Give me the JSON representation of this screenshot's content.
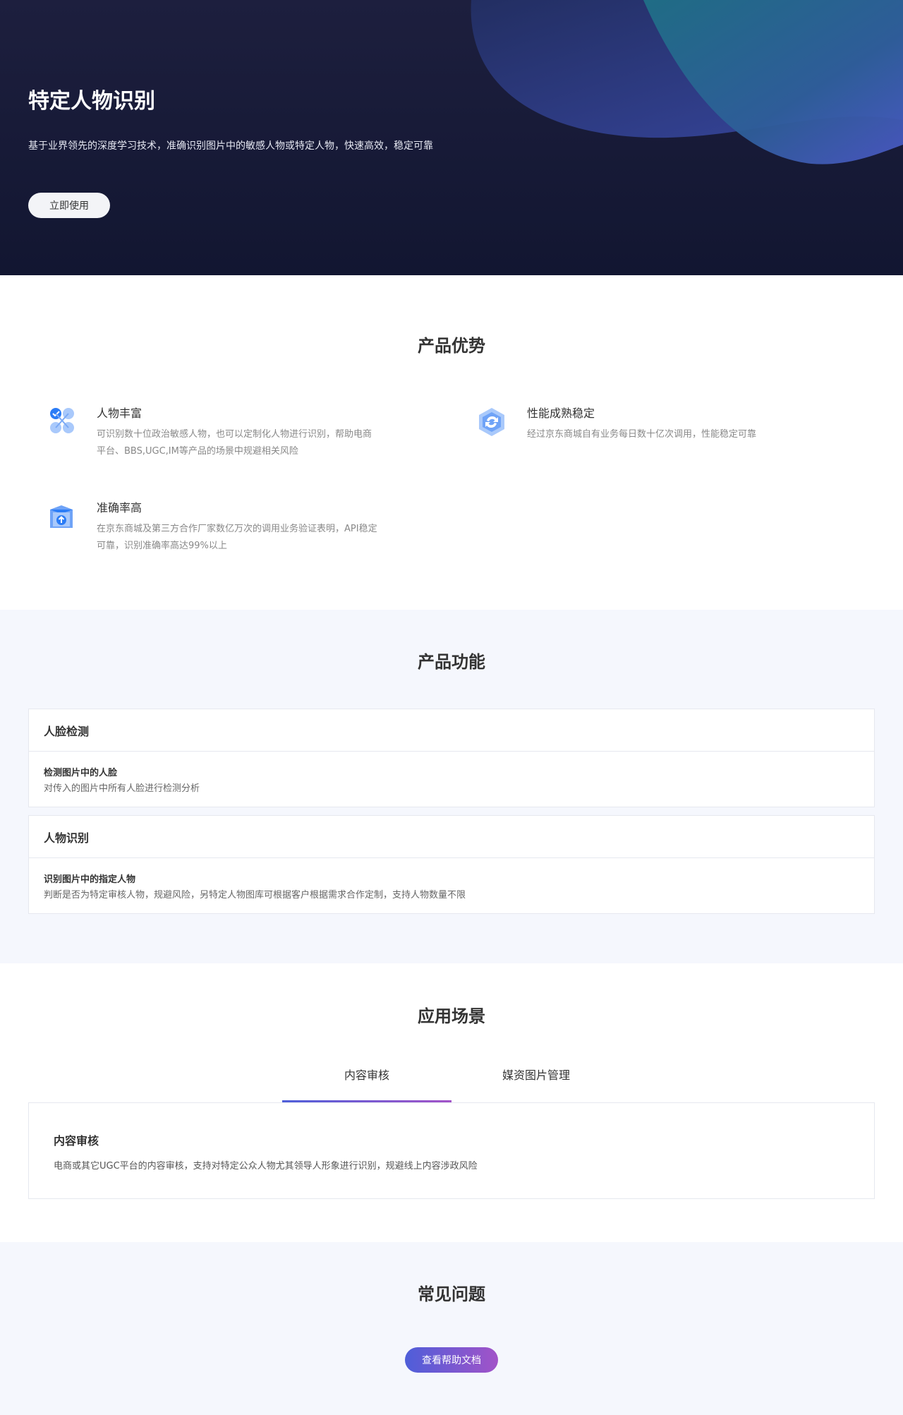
{
  "hero": {
    "title": "特定人物识别",
    "description": "基于业界领先的深度学习技术，准确识别图片中的敏感人物或特定人物，快速高效，稳定可靠",
    "cta_label": "立即使用"
  },
  "advantages": {
    "title": "产品优势",
    "items": [
      {
        "icon": "nodes-check-icon",
        "title": "人物丰富",
        "desc": "可识别数十位政治敏感人物，也可以定制化人物进行识别，帮助电商平台、BBS,UGC,IM等产品的场景中规避相关风险"
      },
      {
        "icon": "refresh-hexagon-icon",
        "title": "性能成熟稳定",
        "desc": "经过京东商城自有业务每日数十亿次调用，性能稳定可靠"
      },
      {
        "icon": "upload-box-icon",
        "title": "准确率高",
        "desc": "在京东商城及第三方合作厂家数亿万次的调用业务验证表明，API稳定可靠，识别准确率高达99%以上"
      }
    ]
  },
  "features": {
    "title": "产品功能",
    "items": [
      {
        "title": "人脸检测",
        "subtitle": "检测图片中的人脸",
        "desc": "对传入的图片中所有人脸进行检测分析"
      },
      {
        "title": "人物识别",
        "subtitle": "识别图片中的指定人物",
        "desc": "判断是否为特定审核人物，规避风险，另特定人物图库可根据客户根据需求合作定制，支持人物数量不限"
      }
    ]
  },
  "scenarios": {
    "title": "应用场景",
    "tabs": [
      "内容审核",
      "媒资图片管理"
    ],
    "active_tab": "内容审核",
    "panel": {
      "title": "内容审核",
      "desc": "电商或其它UGC平台的内容审核，支持对特定公众人物尤其领导人形象进行识别，规避线上内容涉政风险"
    }
  },
  "faq": {
    "title": "常见问题",
    "button_label": "查看帮助文档"
  },
  "colors": {
    "hero_bg": "#1d1f3e",
    "accent_start": "#4e5ed9",
    "accent_end": "#a253c8",
    "section_bg": "#f5f7fd",
    "icon_blue": "#2b7cf6"
  }
}
